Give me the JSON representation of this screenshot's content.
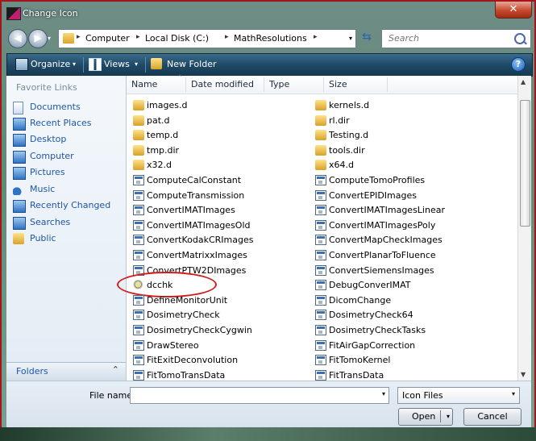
{
  "window": {
    "title": "Change Icon",
    "close_glyph": "✕"
  },
  "nav": {
    "back_glyph": "◀",
    "forward_glyph": "▶",
    "breadcrumbs": [
      "Computer",
      "Local Disk (C:)",
      "MathResolutions"
    ],
    "separator": "▸",
    "dropdown_glyph": "▾",
    "refresh_glyph": "⇆",
    "search_placeholder": "Search"
  },
  "toolbar": {
    "organize": "Organize",
    "views": "Views",
    "new_folder": "New Folder",
    "caret": "▾",
    "help": "?"
  },
  "favorites": {
    "header": "Favorite Links",
    "items": [
      {
        "label": "Documents",
        "icon": "documents-icon"
      },
      {
        "label": "Recent Places",
        "icon": "recent-places-icon"
      },
      {
        "label": "Desktop",
        "icon": "desktop-icon"
      },
      {
        "label": "Computer",
        "icon": "computer-icon"
      },
      {
        "label": "Pictures",
        "icon": "pictures-icon"
      },
      {
        "label": "Music",
        "icon": "music-icon"
      },
      {
        "label": "Recently Changed",
        "icon": "recently-changed-icon"
      },
      {
        "label": "Searches",
        "icon": "searches-icon"
      },
      {
        "label": "Public",
        "icon": "public-folder-icon"
      }
    ],
    "folders_label": "Folders",
    "folders_chevron": "⌃"
  },
  "columns": {
    "name": "Name",
    "date_modified": "Date modified",
    "type": "Type",
    "size": "Size",
    "sort_caret": "^"
  },
  "files_left": [
    {
      "name": "images.d",
      "kind": "folder"
    },
    {
      "name": "pat.d",
      "kind": "folder"
    },
    {
      "name": "temp.d",
      "kind": "folder"
    },
    {
      "name": "tmp.dir",
      "kind": "folder"
    },
    {
      "name": "x32.d",
      "kind": "folder"
    },
    {
      "name": "ComputeCalConstant",
      "kind": "exe"
    },
    {
      "name": "ComputeTransmission",
      "kind": "exe"
    },
    {
      "name": "ConvertIMATImages",
      "kind": "exe"
    },
    {
      "name": "ConvertIMATImagesOld",
      "kind": "exe"
    },
    {
      "name": "ConvertKodakCRImages",
      "kind": "exe"
    },
    {
      "name": "ConvertMatrixxImages",
      "kind": "exe"
    },
    {
      "name": "ConvertPTW2DImages",
      "kind": "exe"
    },
    {
      "name": "dcchk",
      "kind": "special"
    },
    {
      "name": "DefineMonitorUnit",
      "kind": "exe"
    },
    {
      "name": "DosimetryCheck",
      "kind": "exe"
    },
    {
      "name": "DosimetryCheckCygwin",
      "kind": "exe"
    },
    {
      "name": "DrawStereo",
      "kind": "exe"
    },
    {
      "name": "FitExitDeconvolution",
      "kind": "exe"
    },
    {
      "name": "FitTomoTransData",
      "kind": "exe"
    }
  ],
  "files_right": [
    {
      "name": "kernels.d",
      "kind": "folder"
    },
    {
      "name": "rl.dir",
      "kind": "folder"
    },
    {
      "name": "Testing.d",
      "kind": "folder"
    },
    {
      "name": "tools.dir",
      "kind": "folder"
    },
    {
      "name": "x64.d",
      "kind": "folder"
    },
    {
      "name": "ComputeTomoProfiles",
      "kind": "exe"
    },
    {
      "name": "ConvertEPIDImages",
      "kind": "exe"
    },
    {
      "name": "ConvertIMATImagesLinear",
      "kind": "exe"
    },
    {
      "name": "ConvertIMATImagesPoly",
      "kind": "exe"
    },
    {
      "name": "ConvertMapCheckImages",
      "kind": "exe"
    },
    {
      "name": "ConvertPlanarToFluence",
      "kind": "exe"
    },
    {
      "name": "ConvertSiemensImages",
      "kind": "exe"
    },
    {
      "name": "DebugConverIMAT",
      "kind": "exe"
    },
    {
      "name": "DicomChange",
      "kind": "exe"
    },
    {
      "name": "DosimetryCheck64",
      "kind": "exe"
    },
    {
      "name": "DosimetryCheckTasks",
      "kind": "exe"
    },
    {
      "name": "FitAirGapCorrection",
      "kind": "exe"
    },
    {
      "name": "FitTomoKernel",
      "kind": "exe"
    },
    {
      "name": "FitTransData",
      "kind": "exe"
    }
  ],
  "bottom": {
    "file_name_label": "File name:",
    "file_name_value": "",
    "filter": "Icon Files",
    "open": "Open",
    "cancel": "Cancel",
    "dropdown_glyph": "▾"
  },
  "colors": {
    "highlight_annotation": "#d11c1c",
    "link_blue": "#1f56a8",
    "toolbar_dark": "#1f4a68"
  }
}
